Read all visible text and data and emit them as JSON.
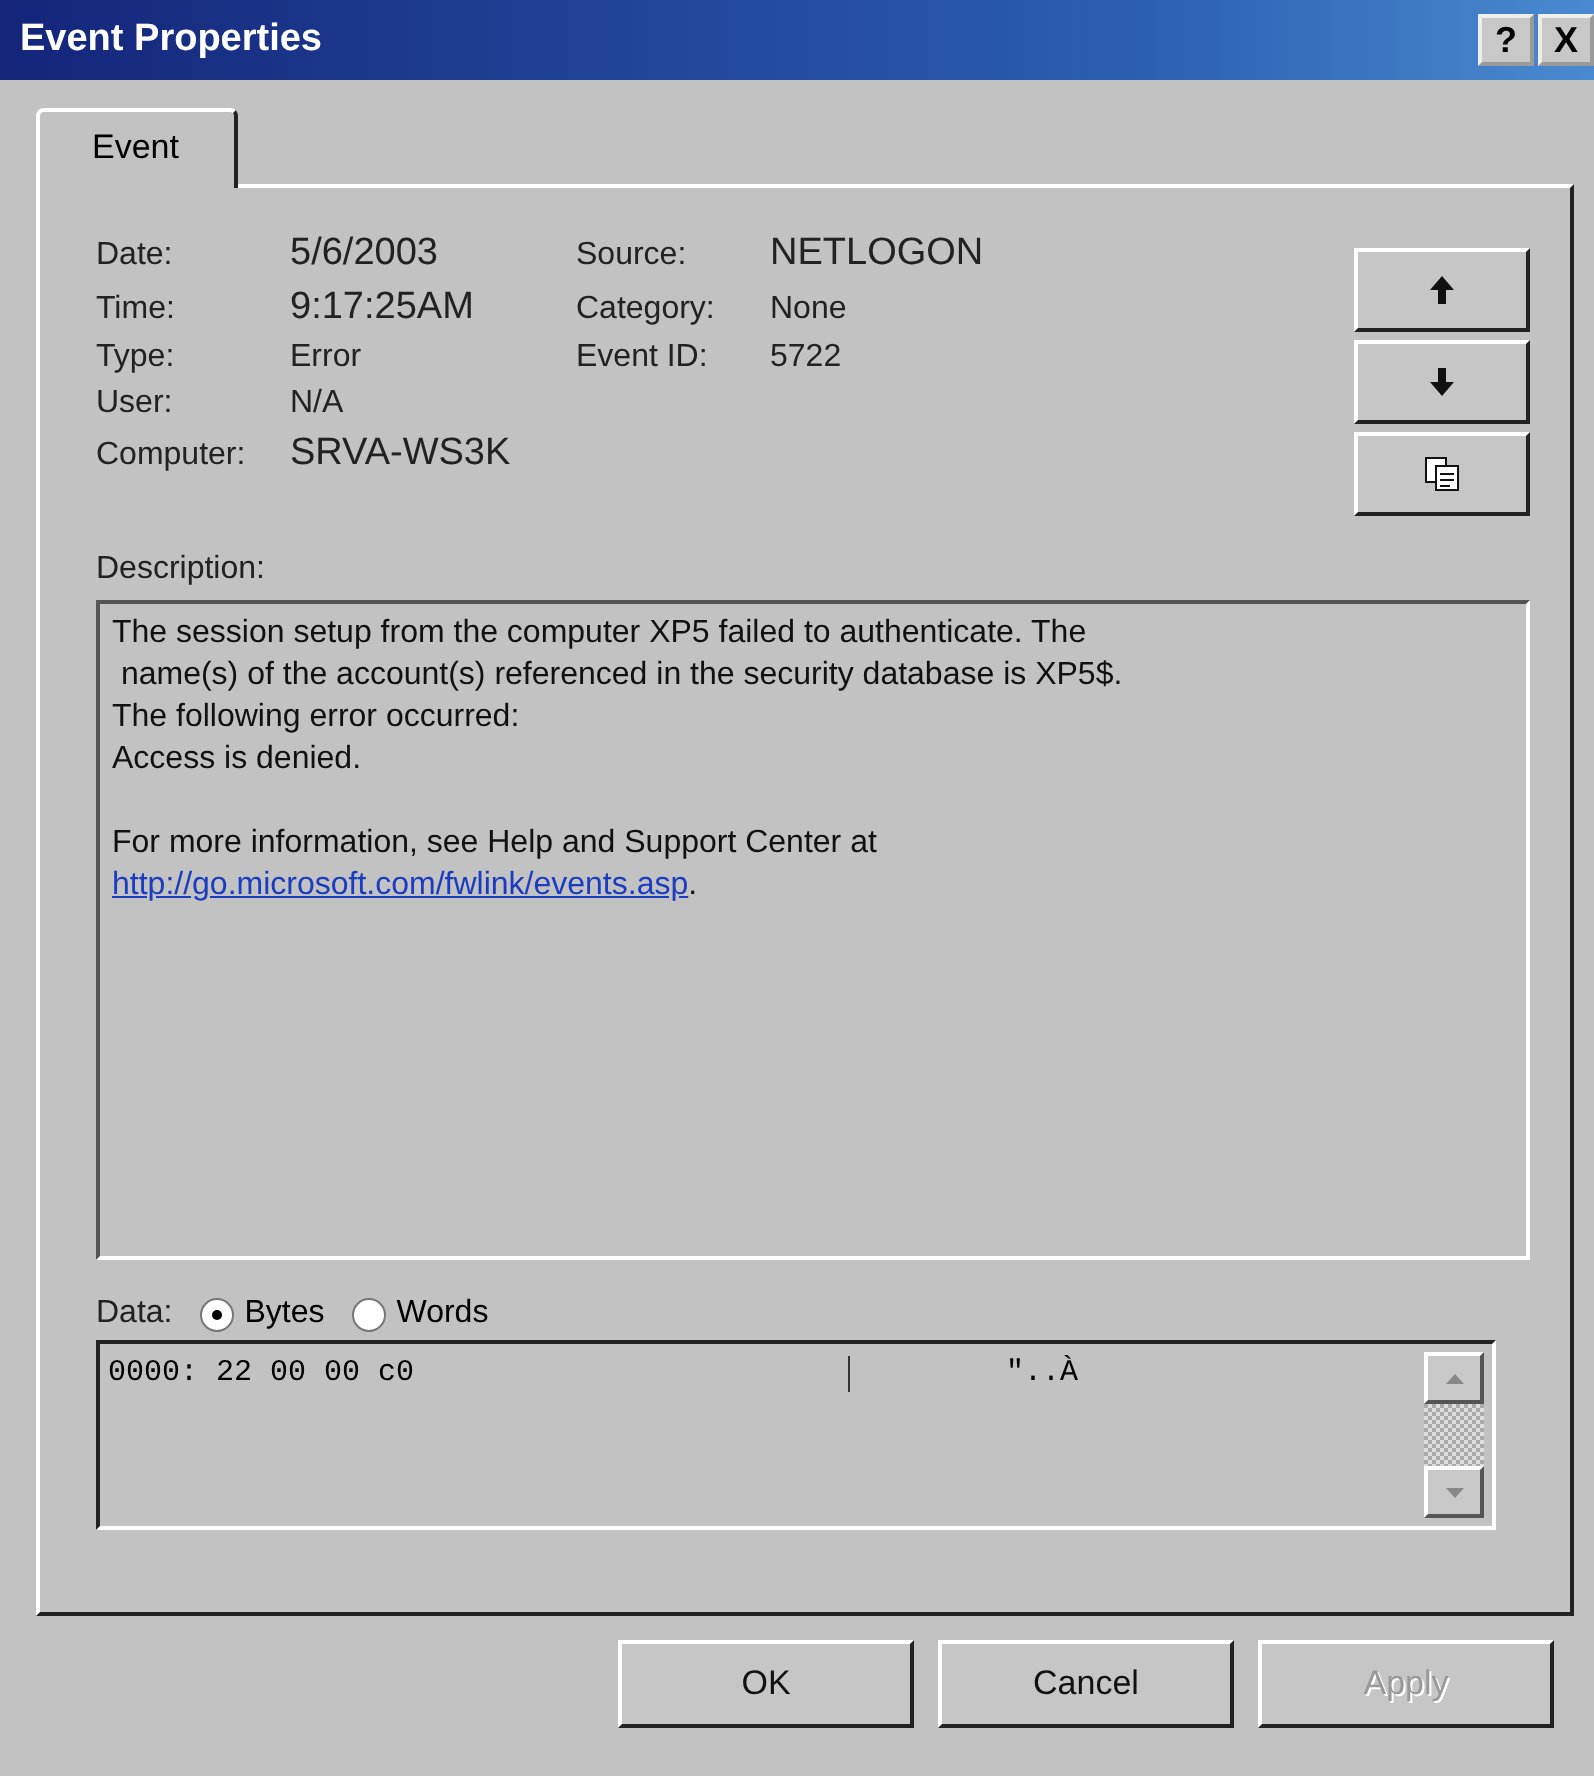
{
  "window": {
    "title": "Event Properties",
    "title_buttons": [
      "?",
      "X"
    ]
  },
  "tabs": [
    {
      "label": "Event",
      "selected": true
    }
  ],
  "fields": [
    {
      "label": "Date:",
      "value": "5/6/2003",
      "kind": "large"
    },
    {
      "label": "Source:",
      "value": "NETLOGON",
      "kind": "large"
    },
    {
      "label": "Time:",
      "value": "9:17:25AM",
      "kind": "large"
    },
    {
      "label": "Category:",
      "value": "None",
      "kind": "small"
    },
    {
      "label": "Type:",
      "value": "Error",
      "kind": "small"
    },
    {
      "label": "Event ID:",
      "value": "5722",
      "kind": "small"
    },
    {
      "label": "User:",
      "value": "N/A",
      "kind": "small"
    }
  ],
  "computer": {
    "label": "Computer:",
    "value": "SRVA-WS3K"
  },
  "nav_buttons": [
    {
      "kind": "up"
    },
    {
      "kind": "down"
    },
    {
      "kind": "copy"
    }
  ],
  "description": {
    "label": "Description:",
    "text": "The session setup from the computer XP5 failed to authenticate. The\n name(s) of the account(s) referenced in the security database is XP5$.\nThe following error occurred:\nAccess is denied.",
    "more_info": "For more information, see Help and Support Center at",
    "link": "http://go.microsoft.com/fwlink/events.asp",
    "link_suffix": "."
  },
  "data": {
    "label": "Data:",
    "options": [
      {
        "label": "Bytes",
        "selected": true
      },
      {
        "label": "Words",
        "selected": false
      }
    ],
    "rows": [
      {
        "hex": "0000: 22 00 00 c0",
        "chars": "\"..À"
      }
    ]
  },
  "buttons": [
    {
      "label": "OK",
      "disabled": false
    },
    {
      "label": "Cancel",
      "disabled": false
    },
    {
      "label": "Apply",
      "disabled": true
    }
  ]
}
